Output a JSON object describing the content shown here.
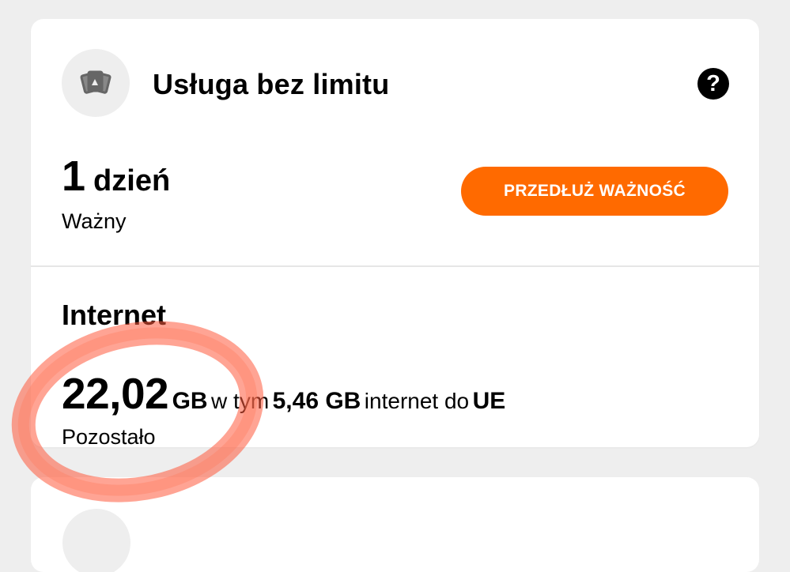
{
  "service": {
    "title": "Usługa bez limitu",
    "icon": "cards-icon",
    "help_icon_glyph": "?"
  },
  "validity": {
    "value": "1",
    "unit": "dzień",
    "label": "Ważny",
    "extend_button_label": "PRZEDŁUŻ WAŻNOŚĆ"
  },
  "internet": {
    "title": "Internet",
    "amount": "22,02",
    "unit": "GB",
    "including_text": "w tym",
    "eu_amount": "5,46 GB",
    "eu_text": "internet do",
    "eu_label": "UE",
    "remaining_label": "Pozostało"
  },
  "colors": {
    "accent": "#ff6a00",
    "annotation": "#ff5a3c",
    "background": "#eeeeee"
  }
}
